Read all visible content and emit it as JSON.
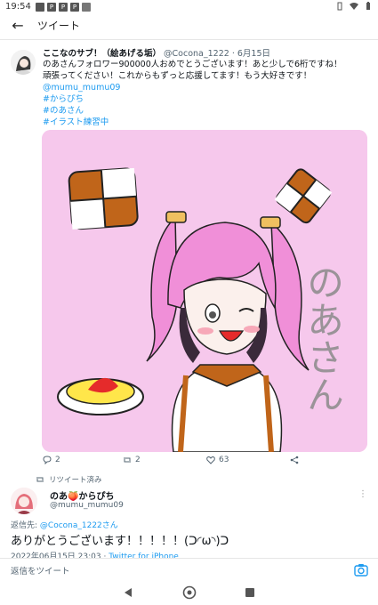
{
  "status_bar": {
    "time": "19:54"
  },
  "app_bar": {
    "title": "ツイート"
  },
  "quoted_tweet": {
    "name": "ここなのサブ！（絵あげる垢）",
    "meta": "@Cocona_1222 · 6月15日",
    "lines": [
      "のあさんフォロワー900000人おめでとうございます！あと少しで6桁ですね！",
      "頑張ってください！これからもずっと応援してます！もう大好きです！"
    ],
    "links": [
      "@mumu_mumu09",
      "#からぴち",
      "#のあさん",
      "#イラスト練習中"
    ],
    "media_alt_colors": {
      "background": "#f6c8ec",
      "hair": "#f08fd8",
      "accent": "#c0651a"
    },
    "media_text": "のあさん",
    "actions": {
      "replies": "2",
      "retweets": "2",
      "likes": "63"
    }
  },
  "retweet_label": "リツイート済み",
  "reply_tweet": {
    "name": "のあ🍑からぴち",
    "handle": "@mumu_mumu09",
    "reply_to_prefix": "返信先: ",
    "reply_to_user": "@Cocona_1222さん",
    "text": "ありがとうございます！！！！！(ᑐ◜ω◝)ᑐ",
    "timestamp": "2022年06月15日 23:03 · ",
    "client": "Twitter for iPhone"
  },
  "reply_bar": {
    "placeholder": "返信をツイート"
  },
  "colors": {
    "link": "#1d9bf0",
    "secondary": "#536471"
  }
}
